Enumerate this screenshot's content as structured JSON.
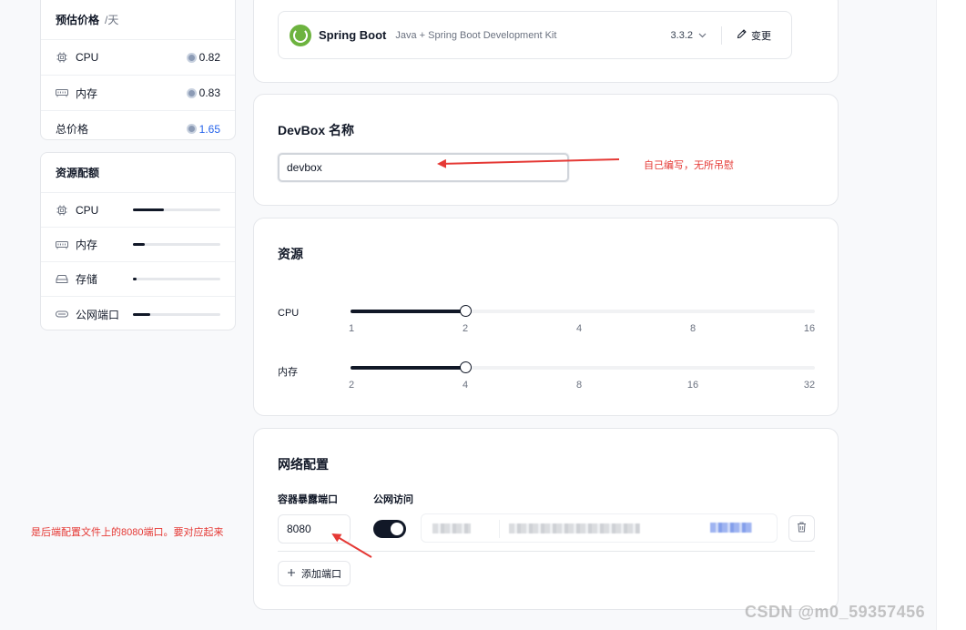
{
  "price": {
    "title": "预估价格",
    "unit": "/天",
    "items": [
      {
        "label": "CPU",
        "icon": "cpu-icon",
        "value": "0.82"
      },
      {
        "label": "内存",
        "icon": "memory-icon",
        "value": "0.83"
      },
      {
        "label": "总价格",
        "value": "1.65"
      }
    ]
  },
  "resources_summary": {
    "title": "资源配额",
    "items": [
      {
        "label": "CPU",
        "icon": "cpu-icon",
        "usage": 0.35
      },
      {
        "label": "内存",
        "icon": "memory-icon",
        "usage": 0.14
      },
      {
        "label": "存储",
        "icon": "storage-icon",
        "usage": 0.04
      },
      {
        "label": "公网端口",
        "icon": "port-icon",
        "usage": 0.2
      }
    ]
  },
  "runtime": {
    "name": "Spring Boot",
    "description": "Java + Spring Boot Development Kit",
    "version": "3.3.2",
    "change_label": "变更"
  },
  "devbox_name": {
    "title": "DevBox 名称",
    "value": "devbox"
  },
  "resources": {
    "title": "资源",
    "cpu": {
      "label": "CPU",
      "ticks": [
        "1",
        "2",
        "4",
        "8",
        "16"
      ],
      "selected_index": 1
    },
    "memory": {
      "label": "内存",
      "ticks": [
        "2",
        "4",
        "8",
        "16",
        "32"
      ],
      "selected_index": 1
    }
  },
  "network": {
    "title": "网络配置",
    "port_label": "容器暴露端口",
    "public_label": "公网访问",
    "port_value": "8080",
    "public_enabled": true,
    "add_port_label": "添加端口"
  },
  "annotations": {
    "name_note": "自己编写，无所吊慰",
    "port_note": "是后端配置文件上的8080端口。要对应起来",
    "color": "#e53935"
  },
  "watermark": "CSDN @m0_59357456"
}
